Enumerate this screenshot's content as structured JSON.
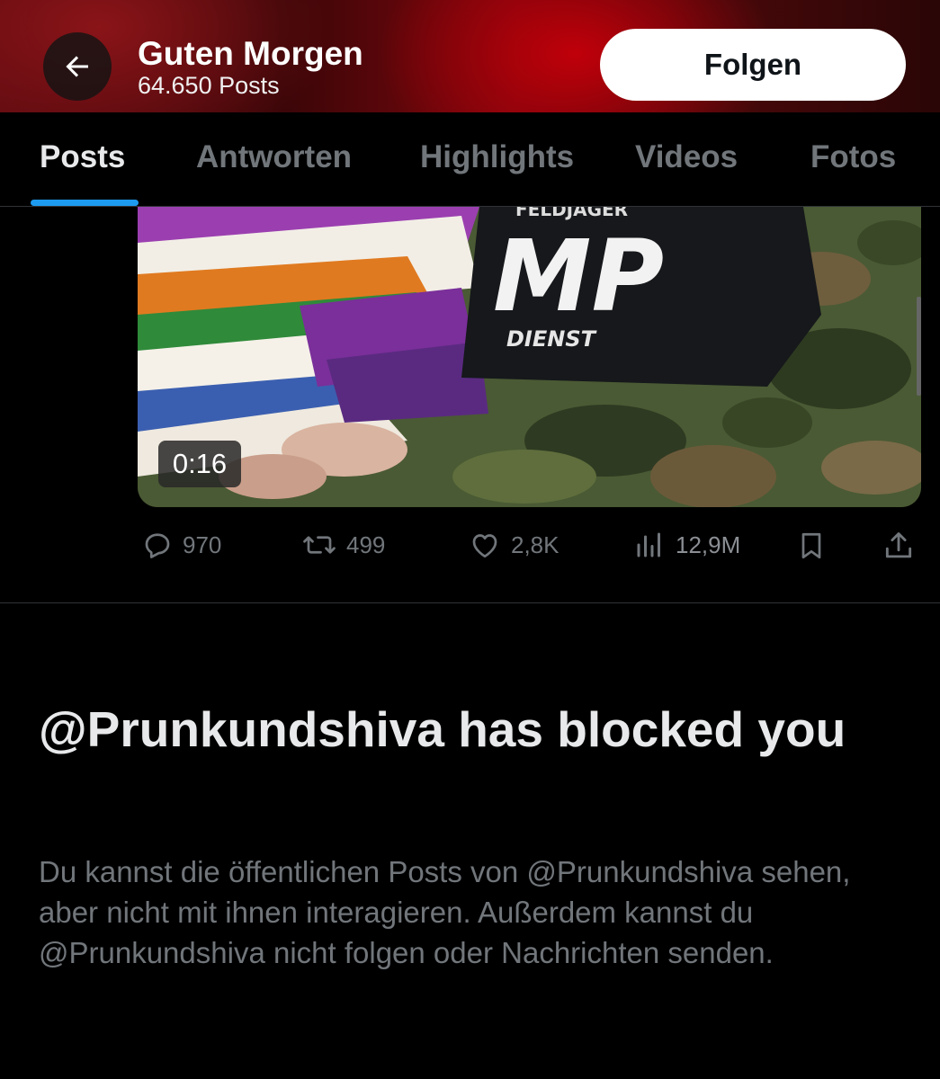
{
  "header": {
    "title": "Guten Morgen",
    "post_count": "64.650 Posts",
    "follow_label": "Folgen",
    "back_icon": "arrow-left-icon"
  },
  "tabs": [
    {
      "label": "Posts",
      "active": true
    },
    {
      "label": "Antworten",
      "active": false
    },
    {
      "label": "Highlights",
      "active": false
    },
    {
      "label": "Videos",
      "active": false
    },
    {
      "label": "Fotos",
      "active": false
    }
  ],
  "post": {
    "media": {
      "patch_text_top": "FELDJÄGER",
      "patch_text_main": "MP",
      "patch_text_bottom": "DIENST",
      "duration": "0:16"
    },
    "actions": {
      "replies": "970",
      "reposts": "499",
      "likes": "2,8K",
      "views": "12,9M"
    }
  },
  "blocked": {
    "title": "@Prunkundshiva has blocked you",
    "message": "Du kannst die öffentlichen Posts von @Prunkundshiva sehen, aber nicht mit ihnen interagieren. Außerdem kannst du @Prunkundshiva nicht folgen oder Nachrichten senden."
  },
  "colors": {
    "accent": "#1d9bf0",
    "header_red": "#c0000a",
    "muted_text": "#71767b"
  }
}
